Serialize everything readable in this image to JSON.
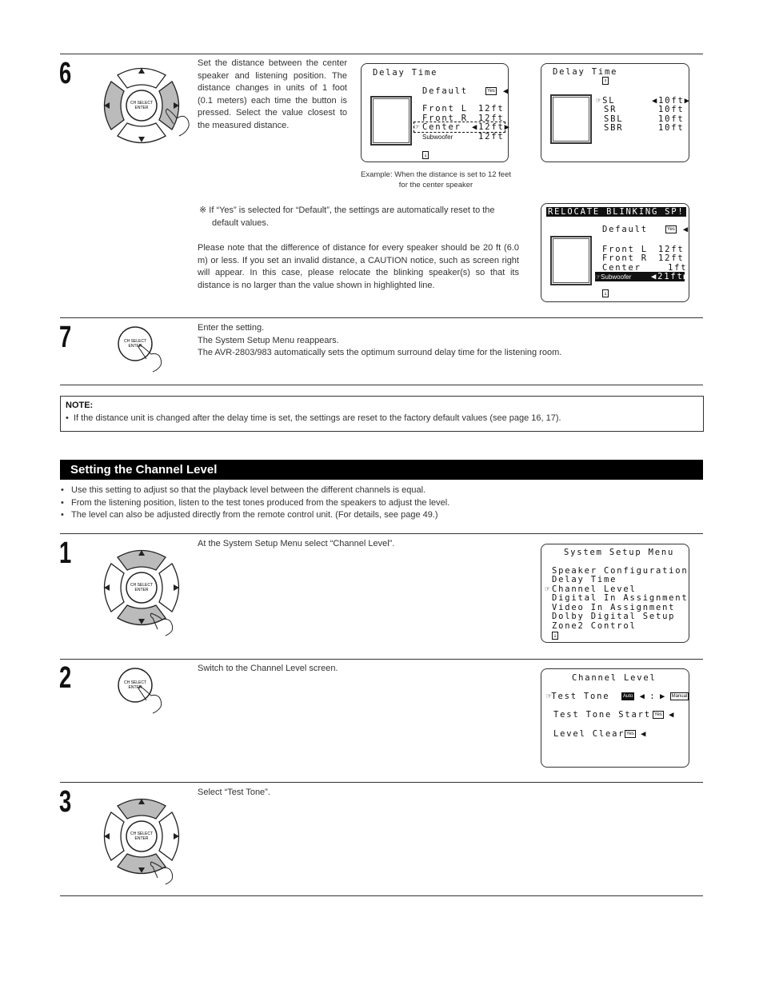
{
  "step6": {
    "number": "6",
    "text": "Set the distance between the center speaker and listening position. The distance changes in units of 1 foot (0.1 meters) each time the button is pressed. Select the value closest to the measured distance.",
    "screen1": {
      "title": "Delay Time",
      "default_label": "Default",
      "default_value": "Yes",
      "rows": [
        {
          "label": "Front L",
          "value": "12ft"
        },
        {
          "label": "Front R",
          "value": "12ft"
        },
        {
          "label": "Center",
          "value": "12ft",
          "selected": true
        },
        {
          "label": "Subwoofer",
          "value": "12ft"
        }
      ]
    },
    "screen2": {
      "title": "Delay Time",
      "rows": [
        {
          "label": "SL",
          "value": "10ft",
          "selected": true
        },
        {
          "label": "SR",
          "value": "10ft"
        },
        {
          "label": "SBL",
          "value": "10ft"
        },
        {
          "label": "SBR",
          "value": "10ft"
        }
      ]
    },
    "caption_line1": "Example: When the distance is set to 12 feet",
    "caption_line2": "for the center speaker",
    "note_default": "※ If “Yes” is selected for “Default”, the settings are automatically reset to the default values.",
    "note_caution": "Please note that the difference of distance for every speaker should be 20 ft (6.0 m) or less. If you set an invalid distance, a CAUTION notice, such as screen right will appear. In this case, please relocate the blinking speaker(s) so that its distance is no larger than the value shown in highlighted line.",
    "screen3": {
      "banner": "RELOCATE BLINKING SP!",
      "default_label": "Default",
      "default_value": "Yes",
      "rows": [
        {
          "label": "Front L",
          "value": "12ft"
        },
        {
          "label": "Front R",
          "value": "12ft"
        },
        {
          "label": "Center",
          "value": "1ft"
        },
        {
          "label": "Subwoofer",
          "value": "21ft",
          "highlighted": true
        }
      ]
    }
  },
  "step7": {
    "number": "7",
    "line1": "Enter the setting.",
    "line2": "The System Setup Menu reappears.",
    "line3": "The AVR-2803/983 automatically sets the optimum surround delay time for the listening room."
  },
  "note": {
    "heading": "NOTE:",
    "text": "If the distance unit is changed after the delay time is set, the settings are reset to the factory default values (see page 16, 17)."
  },
  "section": {
    "title": "Setting the Channel Level",
    "bullets": [
      "Use this setting to adjust so that the playback level between the different channels is equal.",
      "From the listening position, listen to the test tones produced from the speakers to adjust the level.",
      "The level can also be adjusted directly from the remote control unit. (For details, see page 49.)"
    ]
  },
  "cl_step1": {
    "number": "1",
    "text": "At the System Setup Menu select “Channel Level”.",
    "screen": {
      "title": "System Setup Menu",
      "items": [
        "Speaker Configuration",
        "Delay Time",
        "Channel Level",
        "Digital In Assignment",
        "Video In Assignment",
        "Dolby Digital Setup",
        "Zone2 Control"
      ],
      "selected_index": 2
    }
  },
  "cl_step2": {
    "number": "2",
    "text": "Switch to the Channel Level screen.",
    "screen": {
      "title": "Channel Level",
      "test_tone_label": "Test Tone",
      "test_tone_auto": "Auto",
      "test_tone_manual": "Manual",
      "test_tone_start_label": "Test Tone Start",
      "test_tone_start_value": "Yes",
      "level_clear_label": "Level Clear",
      "level_clear_value": "Yes"
    }
  },
  "cl_step3": {
    "number": "3",
    "text": "Select “Test Tone”."
  },
  "remote": {
    "center_line1": "CH SELECT",
    "center_line2": "ENTER"
  }
}
